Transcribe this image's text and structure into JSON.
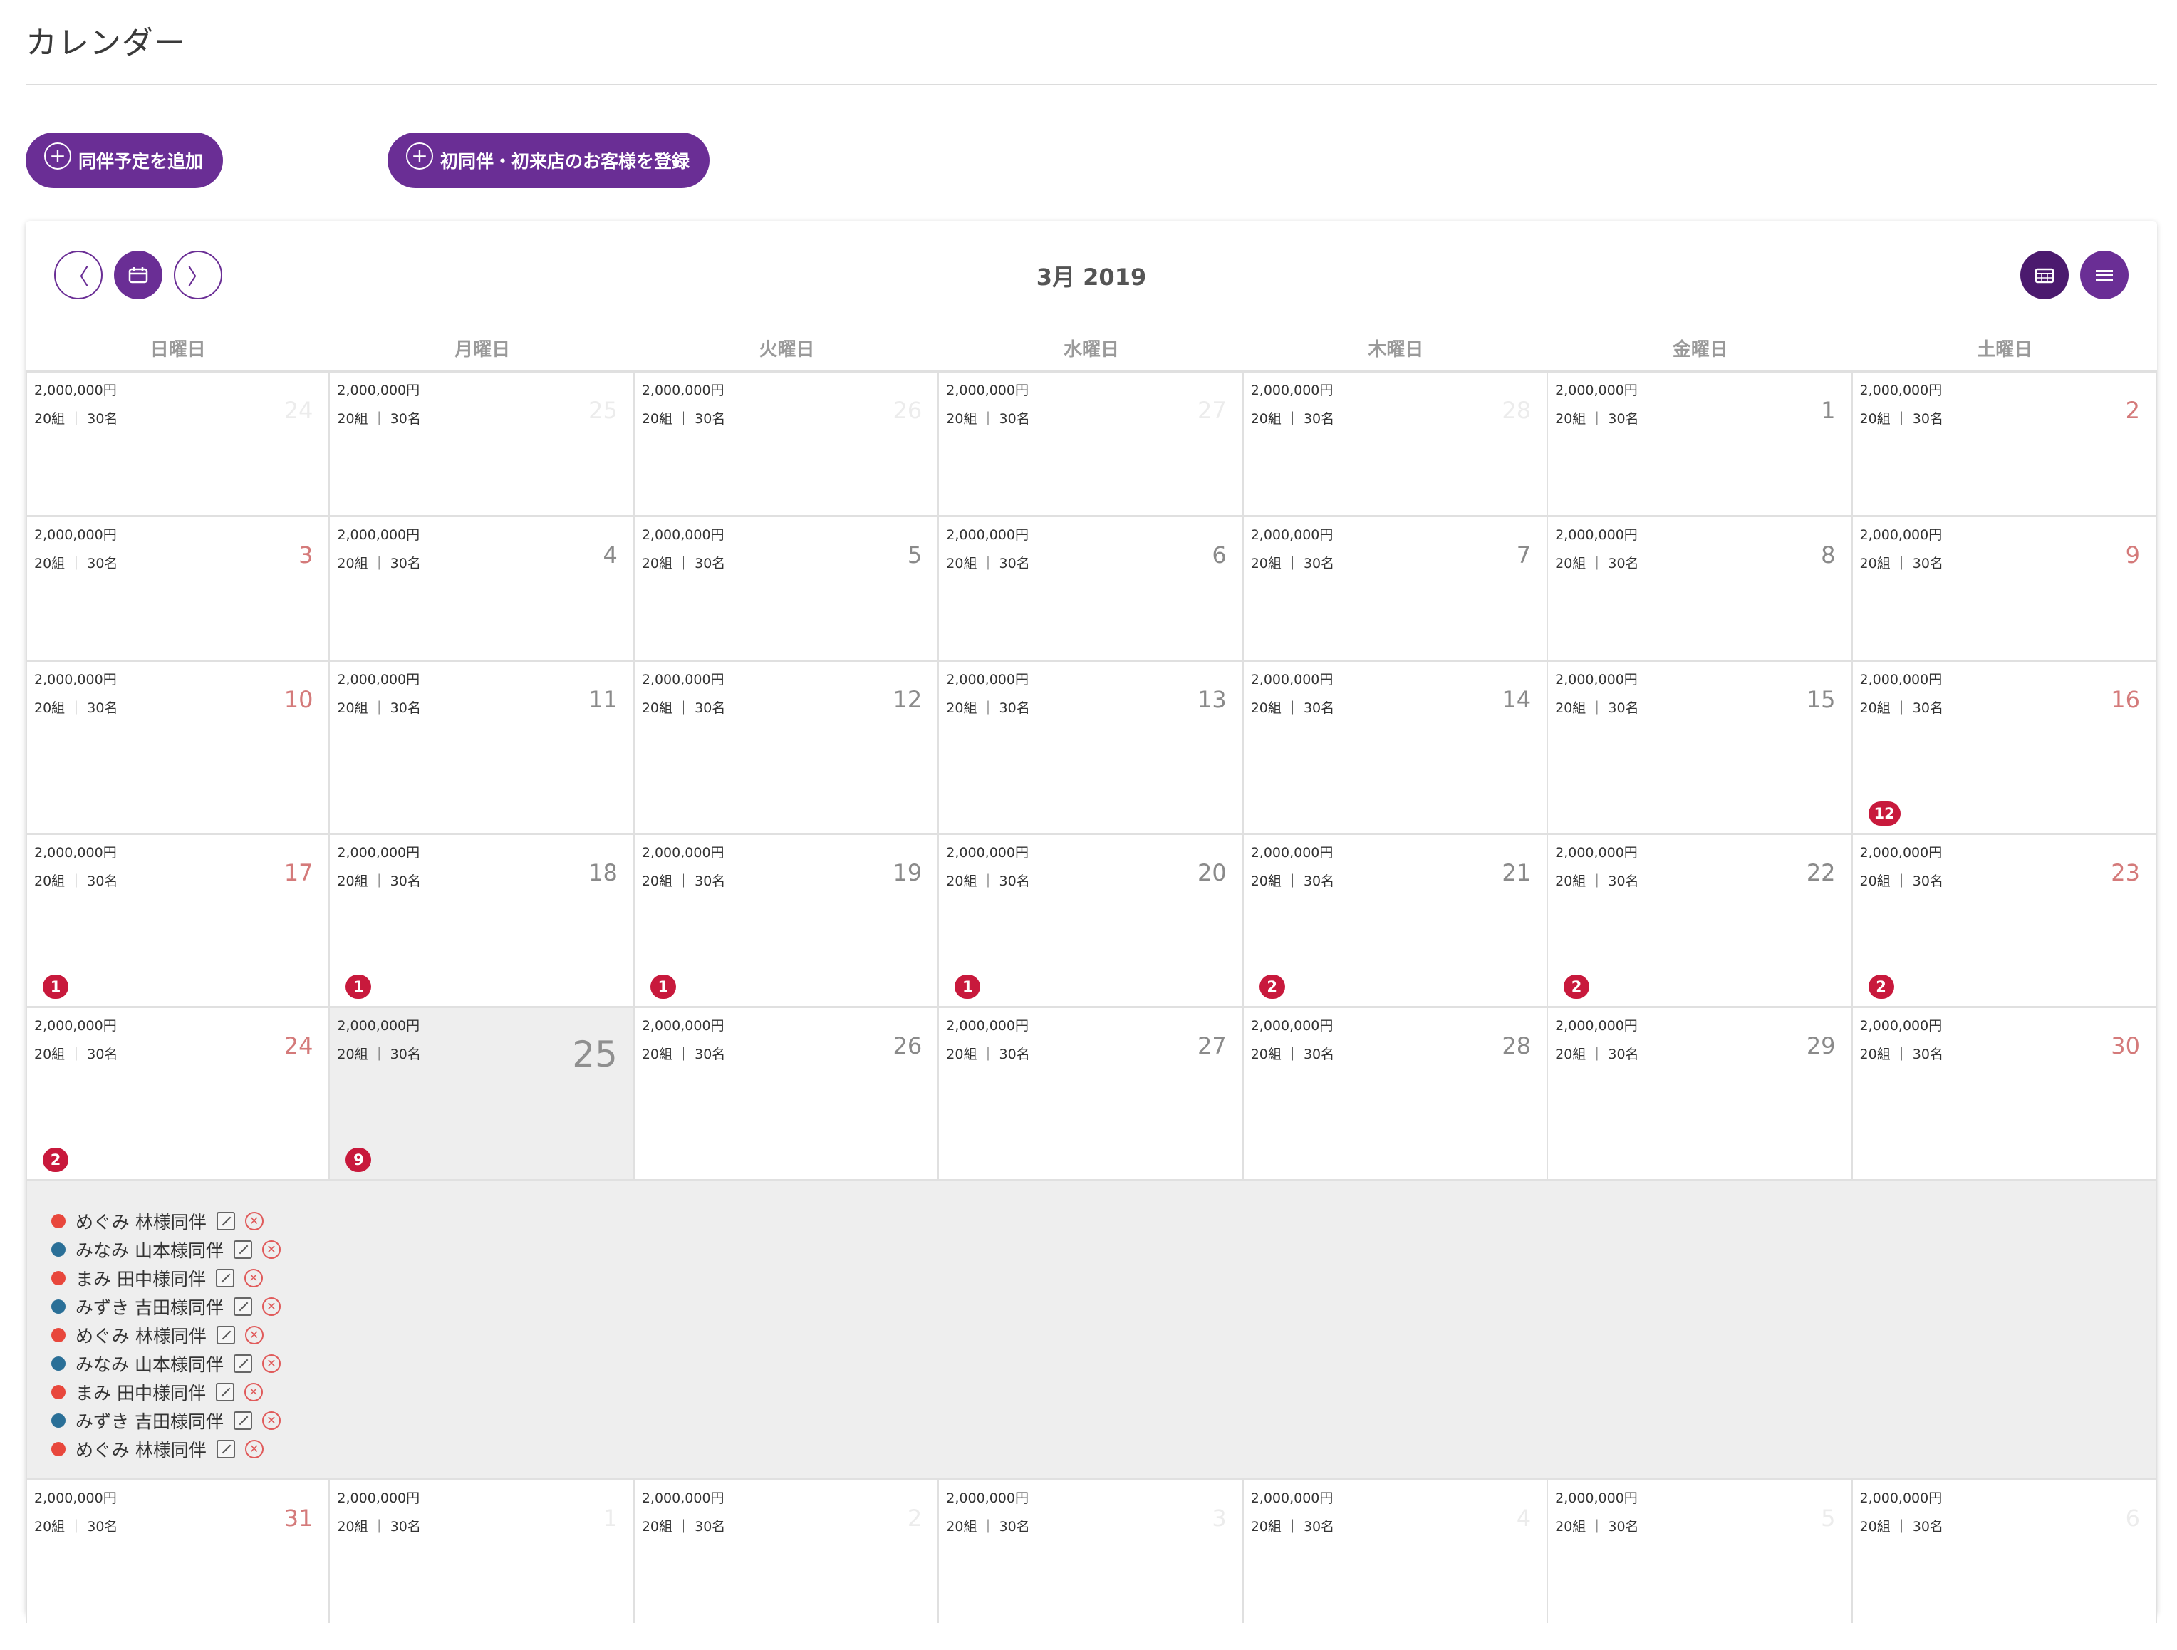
{
  "page": {
    "title": "カレンダー"
  },
  "actions": [
    {
      "label": "同伴予定を追加",
      "icon": "plus-circle-icon"
    },
    {
      "label": "初同伴・初来店のお客様を登録",
      "icon": "plus-circle-icon"
    }
  ],
  "calendar": {
    "month_label": "3月 2019",
    "nav": {
      "prev_icon": "chevron-left-icon",
      "today_icon": "calendar-today-icon",
      "next_icon": "chevron-right-icon"
    },
    "view_toggle": {
      "month_icon": "calendar-grid-icon",
      "list_icon": "list-icon"
    },
    "weekdays": [
      "日曜日",
      "月曜日",
      "火曜日",
      "水曜日",
      "木曜日",
      "金曜日",
      "土曜日"
    ],
    "colors": {
      "primary": "#6a2e95",
      "primary_dark": "#4b1a6e",
      "badge": "#c8193c",
      "weekend_number": "#d47a7a",
      "dot_red": "#e8473c",
      "dot_blue": "#2a6f97"
    },
    "weeks": [
      {
        "days": [
          {
            "day": "24",
            "amount": "2,000,000円",
            "counts": "20組 ｜ 30名",
            "weekend": true,
            "other": true
          },
          {
            "day": "25",
            "amount": "2,000,000円",
            "counts": "20組 ｜ 30名",
            "other": true
          },
          {
            "day": "26",
            "amount": "2,000,000円",
            "counts": "20組 ｜ 30名",
            "other": true
          },
          {
            "day": "27",
            "amount": "2,000,000円",
            "counts": "20組 ｜ 30名",
            "other": true
          },
          {
            "day": "28",
            "amount": "2,000,000円",
            "counts": "20組 ｜ 30名",
            "other": true
          },
          {
            "day": "1",
            "amount": "2,000,000円",
            "counts": "20組 ｜ 30名"
          },
          {
            "day": "2",
            "amount": "2,000,000円",
            "counts": "20組 ｜ 30名",
            "weekend": true
          }
        ]
      },
      {
        "days": [
          {
            "day": "3",
            "amount": "2,000,000円",
            "counts": "20組 ｜ 30名",
            "weekend": true
          },
          {
            "day": "4",
            "amount": "2,000,000円",
            "counts": "20組 ｜ 30名"
          },
          {
            "day": "5",
            "amount": "2,000,000円",
            "counts": "20組 ｜ 30名"
          },
          {
            "day": "6",
            "amount": "2,000,000円",
            "counts": "20組 ｜ 30名"
          },
          {
            "day": "7",
            "amount": "2,000,000円",
            "counts": "20組 ｜ 30名"
          },
          {
            "day": "8",
            "amount": "2,000,000円",
            "counts": "20組 ｜ 30名"
          },
          {
            "day": "9",
            "amount": "2,000,000円",
            "counts": "20組 ｜ 30名",
            "weekend": true
          }
        ]
      },
      {
        "days": [
          {
            "day": "10",
            "amount": "2,000,000円",
            "counts": "20組 ｜ 30名",
            "weekend": true
          },
          {
            "day": "11",
            "amount": "2,000,000円",
            "counts": "20組 ｜ 30名"
          },
          {
            "day": "12",
            "amount": "2,000,000円",
            "counts": "20組 ｜ 30名"
          },
          {
            "day": "13",
            "amount": "2,000,000円",
            "counts": "20組 ｜ 30名"
          },
          {
            "day": "14",
            "amount": "2,000,000円",
            "counts": "20組 ｜ 30名"
          },
          {
            "day": "15",
            "amount": "2,000,000円",
            "counts": "20組 ｜ 30名"
          },
          {
            "day": "16",
            "amount": "2,000,000円",
            "counts": "20組 ｜ 30名",
            "weekend": true,
            "badge": "12"
          }
        ]
      },
      {
        "days": [
          {
            "day": "17",
            "amount": "2,000,000円",
            "counts": "20組 ｜ 30名",
            "weekend": true,
            "badge": "1"
          },
          {
            "day": "18",
            "amount": "2,000,000円",
            "counts": "20組 ｜ 30名",
            "badge": "1"
          },
          {
            "day": "19",
            "amount": "2,000,000円",
            "counts": "20組 ｜ 30名",
            "badge": "1"
          },
          {
            "day": "20",
            "amount": "2,000,000円",
            "counts": "20組 ｜ 30名",
            "badge": "1"
          },
          {
            "day": "21",
            "amount": "2,000,000円",
            "counts": "20組 ｜ 30名",
            "badge": "2"
          },
          {
            "day": "22",
            "amount": "2,000,000円",
            "counts": "20組 ｜ 30名",
            "badge": "2"
          },
          {
            "day": "23",
            "amount": "2,000,000円",
            "counts": "20組 ｜ 30名",
            "weekend": true,
            "badge": "2"
          }
        ]
      },
      {
        "days": [
          {
            "day": "24",
            "amount": "2,000,000円",
            "counts": "20組 ｜ 30名",
            "weekend": true,
            "badge": "2"
          },
          {
            "day": "25",
            "amount": "2,000,000円",
            "counts": "20組 ｜ 30名",
            "today": true,
            "badge": "9"
          },
          {
            "day": "26",
            "amount": "2,000,000円",
            "counts": "20組 ｜ 30名"
          },
          {
            "day": "27",
            "amount": "2,000,000円",
            "counts": "20組 ｜ 30名"
          },
          {
            "day": "28",
            "amount": "2,000,000円",
            "counts": "20組 ｜ 30名"
          },
          {
            "day": "29",
            "amount": "2,000,000円",
            "counts": "20組 ｜ 30名"
          },
          {
            "day": "30",
            "amount": "2,000,000円",
            "counts": "20組 ｜ 30名",
            "weekend": true
          }
        ]
      },
      {
        "days": [
          {
            "day": "31",
            "amount": "2,000,000円",
            "counts": "20組 ｜ 30名",
            "weekend": true
          },
          {
            "day": "1",
            "amount": "2,000,000円",
            "counts": "20組 ｜ 30名",
            "other": true
          },
          {
            "day": "2",
            "amount": "2,000,000円",
            "counts": "20組 ｜ 30名",
            "other": true
          },
          {
            "day": "3",
            "amount": "2,000,000円",
            "counts": "20組 ｜ 30名",
            "other": true
          },
          {
            "day": "4",
            "amount": "2,000,000円",
            "counts": "20組 ｜ 30名",
            "other": true
          },
          {
            "day": "5",
            "amount": "2,000,000円",
            "counts": "20組 ｜ 30名",
            "other": true
          },
          {
            "day": "6",
            "amount": "2,000,000円",
            "counts": "20組 ｜ 30名",
            "weekend": true,
            "other": true
          }
        ]
      }
    ],
    "expanded_events": [
      {
        "label": "めぐみ 林様同伴",
        "color": "red"
      },
      {
        "label": "みなみ 山本様同伴",
        "color": "blue"
      },
      {
        "label": "まみ 田中様同伴",
        "color": "red"
      },
      {
        "label": "みずき 吉田様同伴",
        "color": "blue"
      },
      {
        "label": "めぐみ 林様同伴",
        "color": "red"
      },
      {
        "label": "みなみ 山本様同伴",
        "color": "blue"
      },
      {
        "label": "まみ 田中様同伴",
        "color": "red"
      },
      {
        "label": "みずき 吉田様同伴",
        "color": "blue"
      },
      {
        "label": "めぐみ 林様同伴",
        "color": "red"
      }
    ]
  }
}
